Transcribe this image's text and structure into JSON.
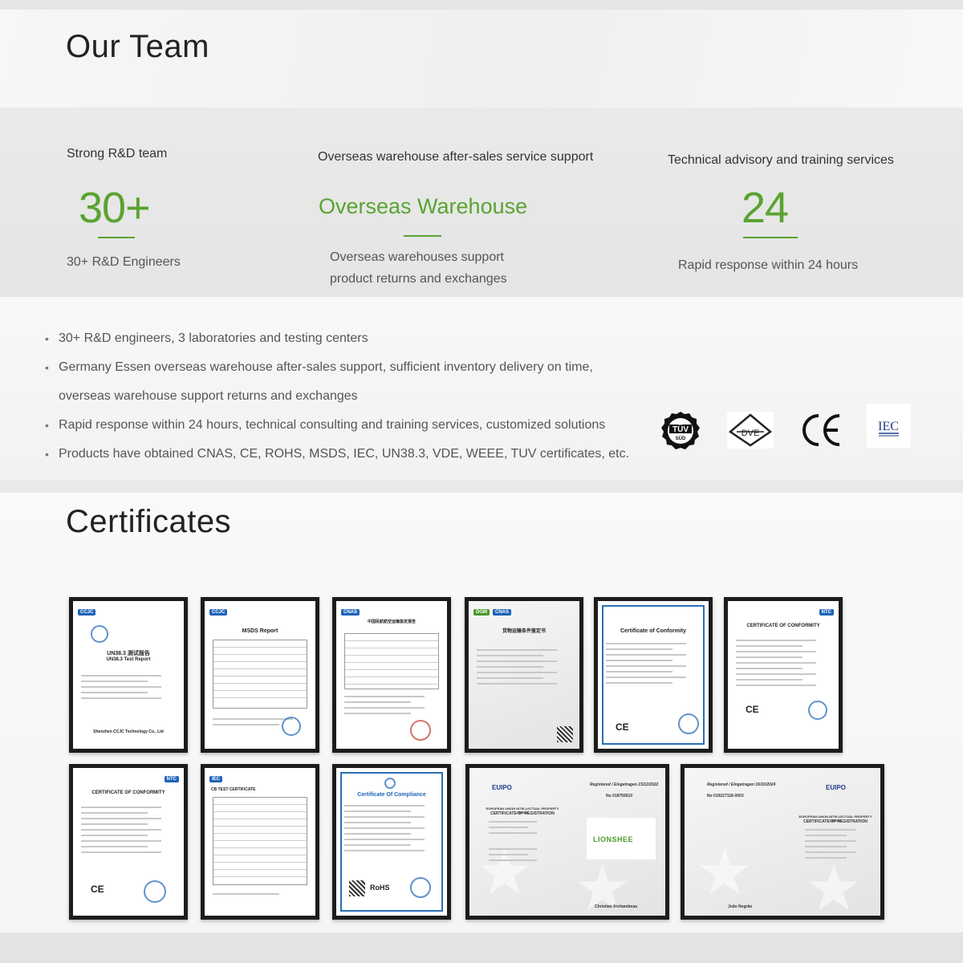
{
  "team": {
    "title": "Our Team",
    "stats": [
      {
        "label": "Strong R&D team",
        "value": "30+",
        "description": "30+ R&D Engineers"
      },
      {
        "label": "Overseas warehouse after-sales service support",
        "value": "Overseas Warehouse",
        "description_line1": "Overseas warehouses support",
        "description_line2": "product returns and exchanges"
      },
      {
        "label": "Technical advisory and training services",
        "value": "24",
        "description": "Rapid response within 24 hours"
      }
    ],
    "accent_color": "#5aa332"
  },
  "bullets": [
    {
      "text": "30+ R&D engineers, 3 laboratories and testing centers"
    },
    {
      "text": "Germany Essen overseas warehouse after-sales support, sufficient inventory delivery on time,"
    },
    {
      "text": "overseas warehouse support returns and exchanges",
      "continuation": true
    },
    {
      "text": "Rapid response within 24 hours, technical consulting and training services, customized solutions"
    },
    {
      "text": "Products have obtained CNAS, CE, ROHS, MSDS, IEC, UN38.3, VDE, WEEE, TUV certificates, etc."
    }
  ],
  "logos": {
    "tuv": {
      "line1": "TÜV",
      "line2": "SÜD",
      "icon": "tuv-sud-icon"
    },
    "vde": {
      "text": "DVE",
      "icon": "vde-icon"
    },
    "ce": {
      "text": "CE",
      "icon": "ce-mark-icon"
    },
    "iec": {
      "text": "IEC",
      "icon": "iec-icon"
    }
  },
  "certificates": {
    "title": "Certificates",
    "row1": [
      {
        "id": "un383",
        "heading": "UN38.3 测试报告",
        "subheading": "UN38.3 Test Report",
        "footer": "Shenzhen CCJC Technology Co., Ltd"
      },
      {
        "id": "msds",
        "heading": "MSDS Report"
      },
      {
        "id": "cnas-transport",
        "heading": "中国民航航空运输鉴定报告"
      },
      {
        "id": "sea-transport",
        "heading": "货物运输条件鉴定书"
      },
      {
        "id": "conformity1",
        "heading": "Certificate of Conformity"
      },
      {
        "id": "conformity2",
        "heading": "CERTIFICATE OF CONFORMITY"
      }
    ],
    "row2": [
      {
        "id": "conformity3",
        "heading": "CERTIFICATE OF CONFORMITY"
      },
      {
        "id": "iec-cb",
        "heading": "CB TEST CERTIFICATE"
      },
      {
        "id": "rohs",
        "heading": "Certificate Of Compliance",
        "mark": "RoHS"
      },
      {
        "id": "euipo1",
        "registered": "Registered / Eingetragen 23/12/2022",
        "number": "No 018756610",
        "brand": "LIONSHEE",
        "signatory": "Christian Archambeau"
      },
      {
        "id": "euipo2",
        "registered": "Registered / Eingetragen 16/10/2024",
        "number": "No 019227118-0003",
        "signatory": "João Negrão"
      }
    ],
    "euipo_label": "EUIPO",
    "euipo_office": "EUROPEAN UNION INTELLECTUAL PROPERTY OFFICE",
    "euipo_cert": "CERTIFICATE OF REGISTRATION"
  }
}
